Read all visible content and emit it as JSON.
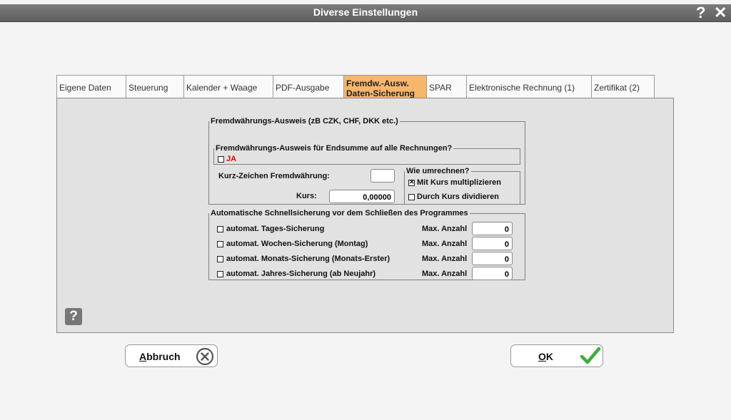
{
  "window": {
    "title": "Diverse Einstellungen",
    "help_glyph": "?",
    "close_glyph": "✕"
  },
  "tabs": [
    {
      "label": "Eigene Daten"
    },
    {
      "label": "Steuerung"
    },
    {
      "label": "Kalender + Waage"
    },
    {
      "label": "PDF-Ausgabe"
    },
    {
      "line1": "Fremdw.-Ausw.",
      "line2": "Daten-Sicherung",
      "active": true
    },
    {
      "label": "SPAR"
    },
    {
      "label": "Elektronische Rechnung (1)"
    },
    {
      "label": "Zertifikat (2)"
    }
  ],
  "currency": {
    "legend": "Fremdwährungs-Ausweis (zB CZK, CHF, DKK  etc.)",
    "endsum_legend": "Fremdwährungs-Ausweis für Endsumme auf alle Rechnungen?",
    "ja_label": "JA",
    "ja_checked": false,
    "code_label": "Kurz-Zeichen Fremdwährung:",
    "code_value": "",
    "rate_label": "Kurs:",
    "rate_value": "0,00000",
    "convert_legend": "Wie umrechnen?",
    "multiply_label": "Mit Kurs multiplizieren",
    "multiply_checked": true,
    "divide_label": "Durch Kurs dividieren",
    "divide_checked": false
  },
  "backup": {
    "legend": "Automatische Schnellsicherung vor dem Schließen des Programmes",
    "max_label": "Max. Anzahl",
    "rows": [
      {
        "label": "automat. Tages-Sicherung",
        "checked": false,
        "max": "0"
      },
      {
        "label": "automat. Wochen-Sicherung (Montag)",
        "checked": false,
        "max": "0"
      },
      {
        "label": "automat. Monats-Sicherung (Monats-Erster)",
        "checked": false,
        "max": "0"
      },
      {
        "label": "automat. Jahres-Sicherung (ab Neujahr)",
        "checked": false,
        "max": "0"
      }
    ]
  },
  "help_button": "?",
  "buttons": {
    "cancel": {
      "mnemonic": "A",
      "rest": "bbruch"
    },
    "ok": {
      "mnemonic": "O",
      "rest": "K"
    }
  },
  "colors": {
    "titlebar": "#6b6b6b",
    "active_tab": "#f6b66b",
    "panel": "#e2e2e2",
    "ja_text": "#e00000",
    "ok_check": "#3cae3c"
  }
}
